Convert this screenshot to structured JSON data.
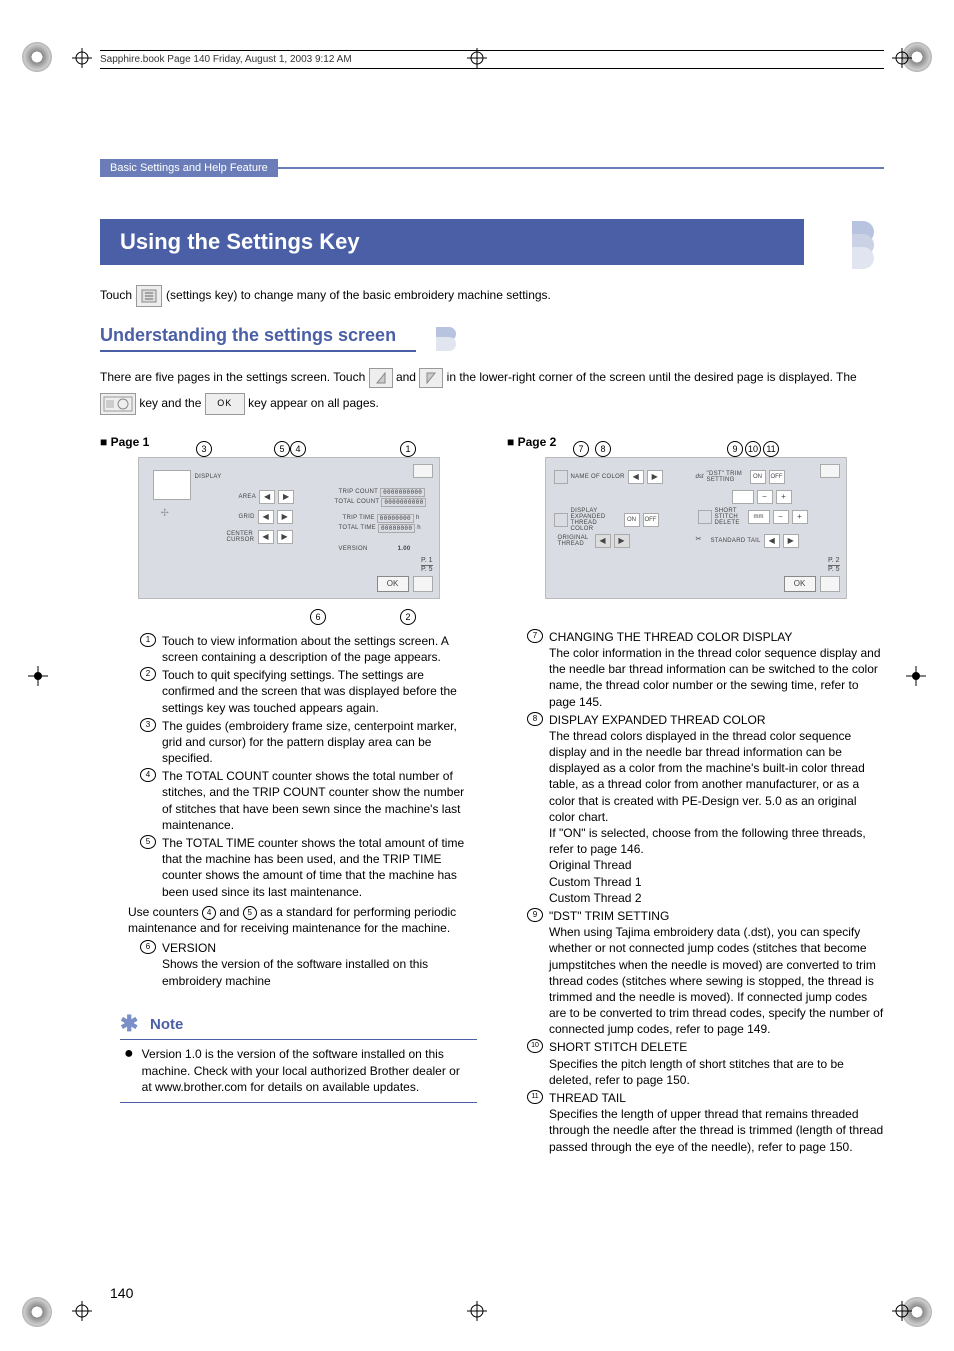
{
  "book_header": "Sapphire.book  Page 140  Friday, August 1, 2003  9:12 AM",
  "chapter": "Basic Settings and Help Feature",
  "title": "Using the Settings Key",
  "intro": {
    "p1a": "Touch",
    "p1b": "(settings key) to change many of the basic embroidery machine settings."
  },
  "section_head": "Understanding the settings screen",
  "para2": {
    "a": "There are five pages in the settings screen. Touch",
    "b": "and",
    "c": "in the lower-right corner of the screen until",
    "d": "the desired page is displayed. The",
    "e": "key and the",
    "f": "key appear on all pages.",
    "ok": "OK"
  },
  "left": {
    "page_label": "Page 1",
    "shot": {
      "display": "DISPLAY",
      "area": "AREA",
      "grid": "GRID",
      "center": "CENTER CURSOR",
      "trip_count": "TRIP COUNT",
      "total_count": "TOTAL COUNT",
      "trip_time": "TRIP TIME",
      "total_time": "TOTAL TIME",
      "time_suffix": "h",
      "count_val": "0000000000",
      "time_val": "00000000",
      "version_lbl": "VERSION",
      "version_val": "1.00",
      "page_ind": "P. 5",
      "page_ind_top": "P. 1",
      "ok": "OK"
    },
    "items": [
      {
        "n": "1",
        "t": "Touch to view information about the settings screen. A screen containing a description of the page appears."
      },
      {
        "n": "2",
        "t": "Touch to quit specifying settings. The settings are confirmed and the screen that was displayed before the settings key was touched appears again."
      },
      {
        "n": "3",
        "t": "The guides (embroidery frame size, centerpoint marker, grid and cursor) for the pattern display area can be specified."
      },
      {
        "n": "4",
        "t": "The TOTAL COUNT counter shows the total number of stitches, and the TRIP COUNT counter show the number of stitches that have been sewn since the machine's last maintenance."
      },
      {
        "n": "5",
        "t": "The TOTAL TIME counter shows the total amount of time that the machine has been used, and the TRIP TIME counter shows the amount of time that the machine has been used since its last maintenance."
      }
    ],
    "use_counters_a": "Use counters ",
    "use_counters_mid": " and ",
    "use_counters_b": " as a standard for performing periodic maintenance and for receiving maintenance for the machine.",
    "uc_n1": "4",
    "uc_n2": "5",
    "item6": {
      "n": "6",
      "head": "VERSION",
      "t": "Shows the version of the software installed on this embroidery machine"
    },
    "note_head": "Note",
    "note_body": "Version 1.0 is the version of the software installed on this machine. Check with your local authorized Brother dealer or at www.brother.com for details on available updates."
  },
  "right": {
    "page_label": "Page 2",
    "shot": {
      "name_of_color": "NAME OF COLOR",
      "dst": "\"DST\" TRIM SETTING",
      "on": "ON",
      "off": "OFF",
      "display_expanded": "DISPLAY EXPANDED THREAD COLOR",
      "short_stitch": "SHORT STITCH DELETE",
      "mm": "mm",
      "original_thread": "ORIGINAL THREAD",
      "standard_tail": "STANDARD TAIL",
      "page_ind": "P. 5",
      "page_ind_top": "P. 2",
      "ok": "OK"
    },
    "items": [
      {
        "n": "7",
        "head": "CHANGING THE THREAD COLOR DISPLAY",
        "t": "The color information in the thread color sequence display and the needle bar thread information can be switched to the color name, the thread color number or the sewing time, refer to page 145."
      },
      {
        "n": "8",
        "head": "DISPLAY EXPANDED THREAD COLOR",
        "t": "The thread colors displayed in the thread color sequence display and in the needle bar thread information can be displayed as a color from the machine's built-in color thread table, as a thread color from another manufacturer, or as a color that is created with PE-Design ver. 5.0 as an original color chart.",
        "t2": "If \"ON\" is selected, choose from the following three threads, refer to page 146.",
        "lines": [
          "Original Thread",
          "Custom Thread 1",
          "Custom Thread 2"
        ]
      },
      {
        "n": "9",
        "head": "\"DST\" TRIM SETTING",
        "t": "When using Tajima embroidery data (.dst), you can specify whether or not connected jump codes (stitches that become jumpstitches when the needle is moved) are converted to trim thread codes (stitches where sewing is stopped, the thread is trimmed and the needle is moved). If connected jump codes are to be converted to trim thread codes, specify the number of connected jump codes, refer to page 149."
      },
      {
        "n": "10",
        "head": "SHORT STITCH DELETE",
        "t": "Specifies the pitch length of short stitches that are to be deleted, refer to page 150."
      },
      {
        "n": "11",
        "head": "THREAD TAIL",
        "t": "Specifies the length of upper thread that remains threaded through the needle after the thread is trimmed (length of thread passed through the eye of the needle), refer to page 150."
      }
    ]
  },
  "page_number": "140"
}
